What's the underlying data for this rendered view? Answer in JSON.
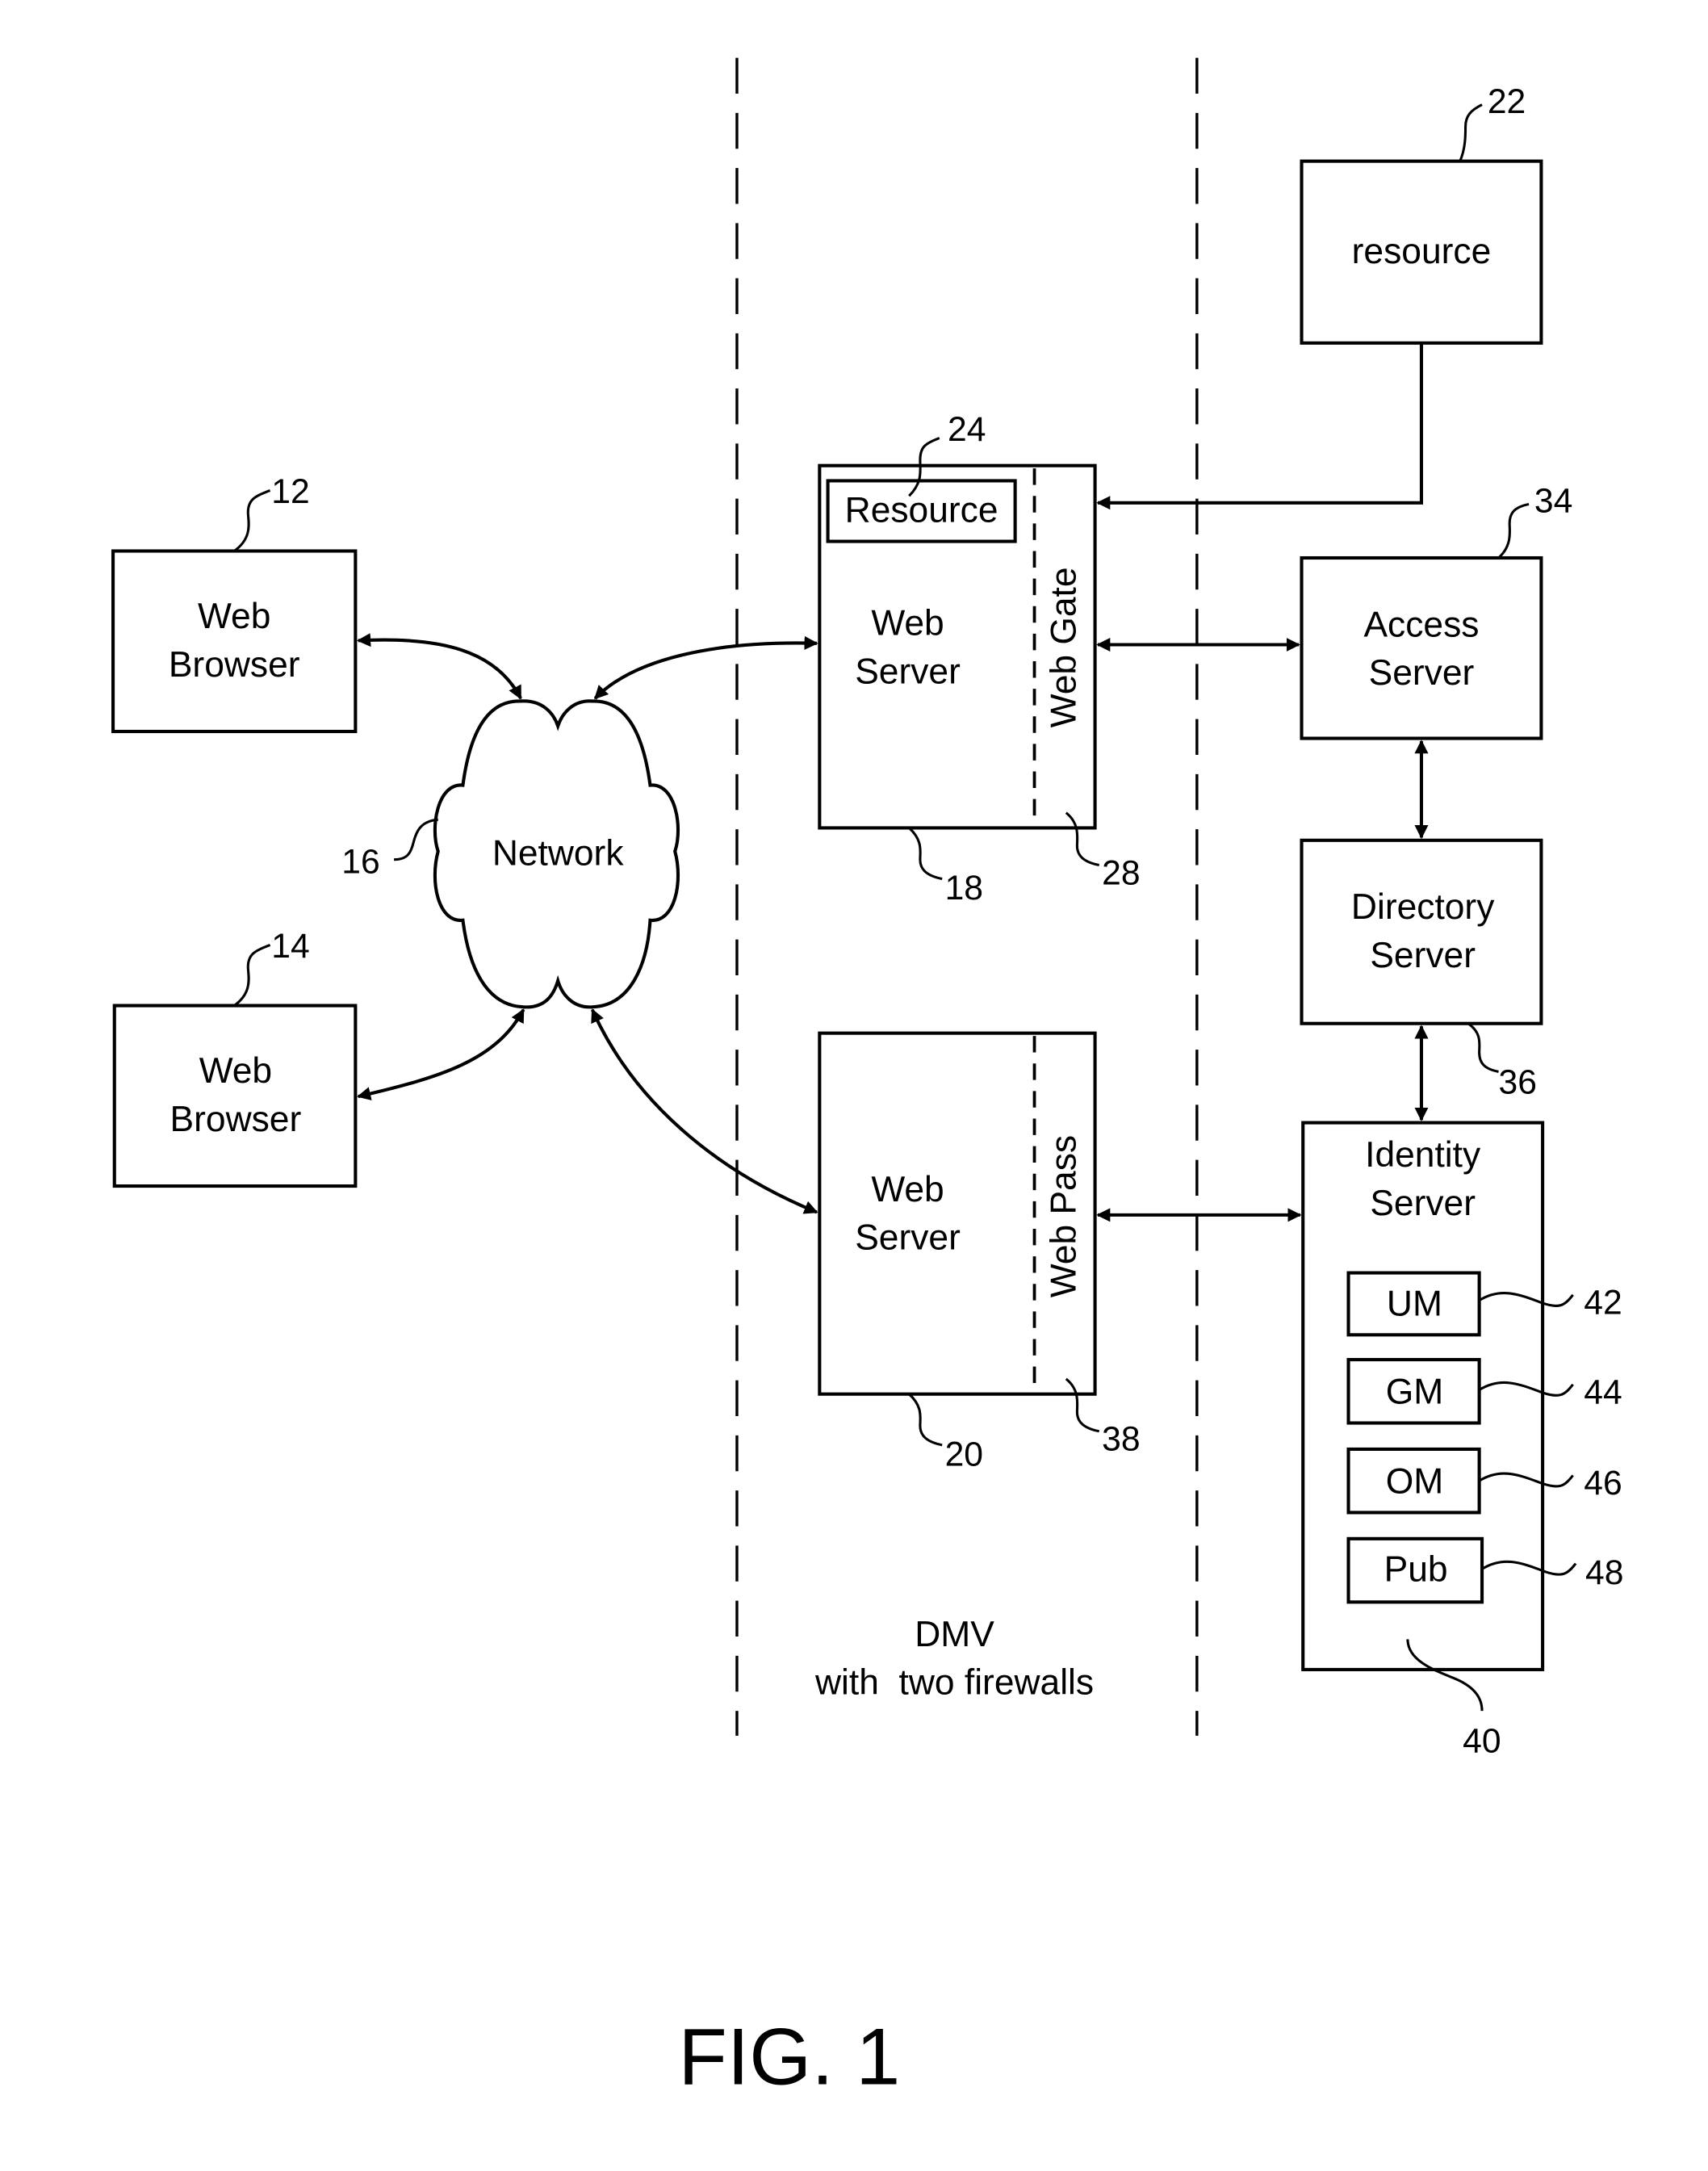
{
  "figure": {
    "caption": "FIG. 1",
    "zone_label_line1": "DMV",
    "zone_label_line2": "with  two firewalls"
  },
  "nodes": {
    "browser_12": {
      "line1": "Web",
      "line2": "Browser",
      "ref": "12"
    },
    "browser_14": {
      "line1": "Web",
      "line2": "Browser",
      "ref": "14"
    },
    "network": {
      "label": "Network",
      "ref": "16"
    },
    "web_server_18": {
      "line1": "Web",
      "line2": "Server",
      "ref": "18",
      "plugin": "Web Gate",
      "plugin_ref": "28",
      "inner_resource": "Resource",
      "inner_resource_ref": "24"
    },
    "web_server_20": {
      "line1": "Web",
      "line2": "Server",
      "ref": "20",
      "plugin": "Web Pass",
      "plugin_ref": "38"
    },
    "resource_22": {
      "label": "resource",
      "ref": "22"
    },
    "access_server": {
      "line1": "Access",
      "line2": "Server",
      "ref": "34"
    },
    "directory_server": {
      "line1": "Directory",
      "line2": "Server",
      "ref": "36"
    },
    "identity_server": {
      "line1": "Identity",
      "line2": "Server",
      "ref": "40",
      "modules": [
        {
          "label": "UM",
          "ref": "42"
        },
        {
          "label": "GM",
          "ref": "44"
        },
        {
          "label": "OM",
          "ref": "46"
        },
        {
          "label": "Pub",
          "ref": "48"
        }
      ]
    }
  }
}
